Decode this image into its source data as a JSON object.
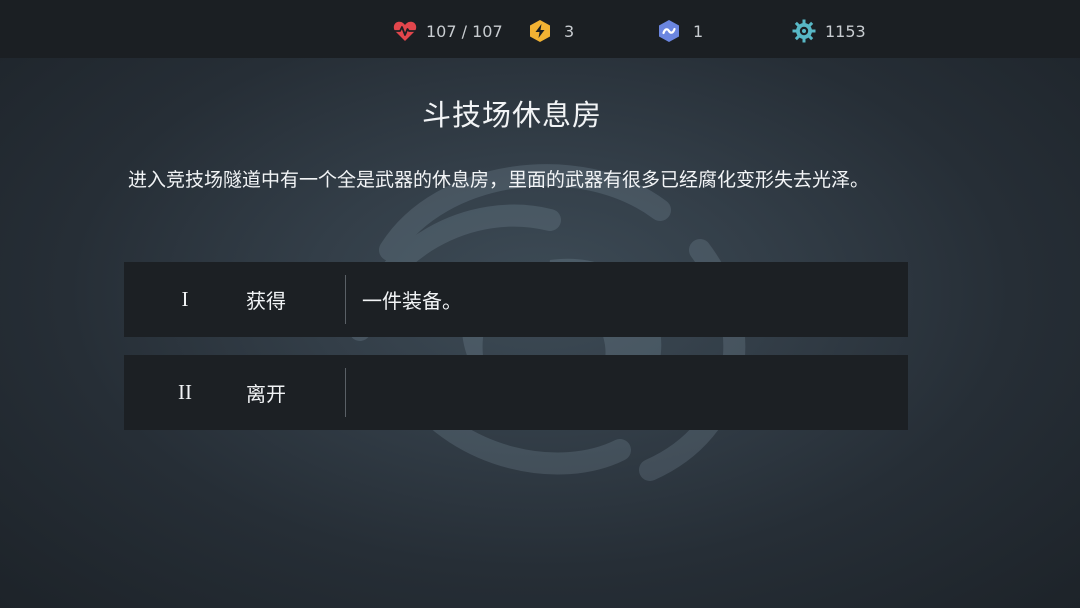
{
  "status": {
    "hp": "107 / 107",
    "energy": "3",
    "token": "1",
    "gold": "1153"
  },
  "icons": {
    "hp": "heart-pulse-icon",
    "energy": "lightning-hexagon-icon",
    "token": "wave-hexagon-icon",
    "gold": "gear-coin-icon"
  },
  "colors": {
    "hp": "#e2464c",
    "energy": "#f2b233",
    "token": "#6b86e0",
    "gold": "#58b8c6"
  },
  "event": {
    "title": "斗技场休息房",
    "description": "进入竞技场隧道中有一个全是武器的休息房，里面的武器有很多已经腐化变形失去光泽。"
  },
  "choices": [
    {
      "numeral": "I",
      "label": "获得",
      "effect": "一件装备。"
    },
    {
      "numeral": "II",
      "label": "离开",
      "effect": ""
    }
  ]
}
